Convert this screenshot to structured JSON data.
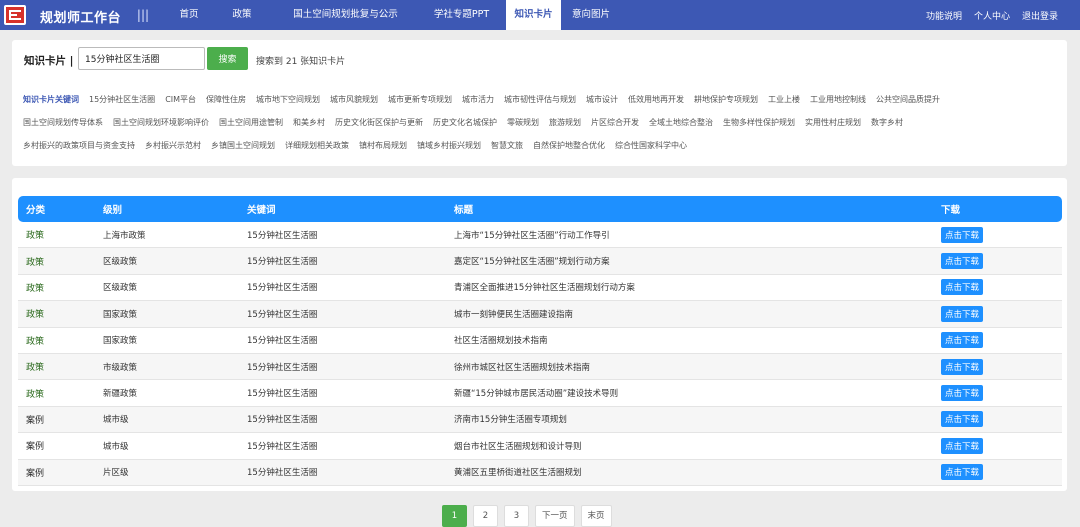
{
  "app": {
    "title": "规划师工作台",
    "menu_icon": "|||"
  },
  "nav": [
    {
      "label": "首页"
    },
    {
      "label": "政策"
    },
    {
      "label": "国土空间规划批复与公示"
    },
    {
      "label": "学社专题PPT"
    },
    {
      "label": "知识卡片"
    },
    {
      "label": "意向图片"
    }
  ],
  "top_links": [
    {
      "label": "功能说明"
    },
    {
      "label": "个人中心"
    },
    {
      "label": "退出登录"
    }
  ],
  "search": {
    "label": "知识卡片 |",
    "value": "15分钟社区生活圈",
    "button": "搜索",
    "result_text": "搜索到 21 张知识卡片"
  },
  "keywords": {
    "lead": "知识卡片关键词",
    "rows": [
      [
        "15分钟社区生活圈",
        "CIM平台",
        "保障性住房",
        "城市地下空间规划",
        "城市风貌规划",
        "城市更新专项规划",
        "城市活力",
        "城市韧性评估与规划",
        "城市设计",
        "低效用地再开发",
        "耕地保护专项规划",
        "工业上楼",
        "工业用地控制线",
        "公共空间品质提升"
      ],
      [
        "国土空间规划传导体系",
        "国土空间规划环境影响评价",
        "国土空间用途管制",
        "和美乡村",
        "历史文化街区保护与更新",
        "历史文化名城保护",
        "零碳规划",
        "旅游规划",
        "片区综合开发",
        "全域土地综合整治",
        "生物多样性保护规划",
        "实用性村庄规划",
        "数字乡村"
      ],
      [
        "乡村振兴的政策项目与资金支持",
        "乡村振兴示范村",
        "乡镇国土空间规划",
        "详细规划相关政策",
        "镇村布局规划",
        "镇域乡村振兴规划",
        "智慧文旅",
        "自然保护地整合优化",
        "综合性国家科学中心"
      ]
    ]
  },
  "table": {
    "headers": [
      "分类",
      "级别",
      "关键词",
      "标题",
      "下载"
    ],
    "rows": [
      {
        "category": "政策",
        "level": "上海市政策",
        "keyword": "15分钟社区生活圈",
        "title": "上海市“15分钟社区生活圈”行动工作导引",
        "download": "点击下载"
      },
      {
        "category": "政策",
        "level": "区级政策",
        "keyword": "15分钟社区生活圈",
        "title": "嘉定区“15分钟社区生活圈”规划行动方案",
        "download": "点击下载"
      },
      {
        "category": "政策",
        "level": "区级政策",
        "keyword": "15分钟社区生活圈",
        "title": "青浦区全面推进15分钟社区生活圈规划行动方案",
        "download": "点击下载"
      },
      {
        "category": "政策",
        "level": "国家政策",
        "keyword": "15分钟社区生活圈",
        "title": "城市一刻钟便民生活圈建设指南",
        "download": "点击下载"
      },
      {
        "category": "政策",
        "level": "国家政策",
        "keyword": "15分钟社区生活圈",
        "title": "社区生活圈规划技术指南",
        "download": "点击下载"
      },
      {
        "category": "政策",
        "level": "市级政策",
        "keyword": "15分钟社区生活圈",
        "title": "徐州市城区社区生活圈规划技术指南",
        "download": "点击下载"
      },
      {
        "category": "政策",
        "level": "新疆政策",
        "keyword": "15分钟社区生活圈",
        "title": "新疆“15分钟城市居民活动圈”建设技术导则",
        "download": "点击下载"
      },
      {
        "category": "案例",
        "level": "城市级",
        "keyword": "15分钟社区生活圈",
        "title": "济南市15分钟生活圈专项规划",
        "download": "点击下载"
      },
      {
        "category": "案例",
        "level": "城市级",
        "keyword": "15分钟社区生活圈",
        "title": "烟台市社区生活圈规划和设计导则",
        "download": "点击下载"
      },
      {
        "category": "案例",
        "level": "片区级",
        "keyword": "15分钟社区生活圈",
        "title": "黄浦区五里桥街道社区生活圈规划",
        "download": "点击下载"
      }
    ]
  },
  "pagination": [
    "1",
    "2",
    "3",
    "下一页",
    "末页"
  ],
  "colors": {
    "nav_bg": "#3d58b4",
    "header_bg": "#1e90ff",
    "search_btn": "#4cae4c",
    "logo": "#d7322b"
  }
}
